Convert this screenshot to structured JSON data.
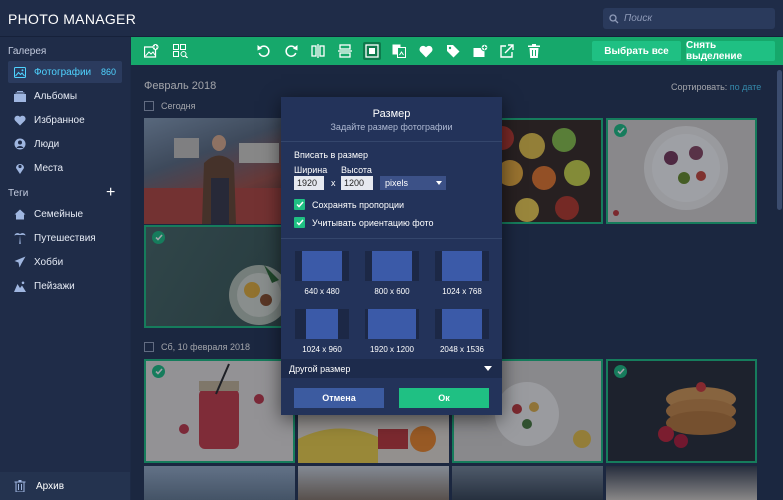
{
  "app": {
    "title": "PHOTO MANAGER"
  },
  "search": {
    "placeholder": "Поиск"
  },
  "sidebar": {
    "gallery_title": "Галерея",
    "gallery_items": [
      {
        "label": "Фотографии",
        "count": "860",
        "icon": "photos-icon"
      },
      {
        "label": "Альбомы",
        "icon": "albums-icon"
      },
      {
        "label": "Избранное",
        "icon": "heart-icon"
      },
      {
        "label": "Люди",
        "icon": "person-icon"
      },
      {
        "label": "Места",
        "icon": "pin-icon"
      }
    ],
    "tags_title": "Теги",
    "tag_items": [
      {
        "label": "Семейные",
        "icon": "house-icon"
      },
      {
        "label": "Путешествия",
        "icon": "palm-icon"
      },
      {
        "label": "Хобби",
        "icon": "plane-icon"
      },
      {
        "label": "Пейзажи",
        "icon": "landscape-icon"
      }
    ],
    "archive_label": "Архив"
  },
  "toolbar": {
    "icons": [
      "add-photo-icon",
      "scan-icon",
      "rotate-left-icon",
      "rotate-right-icon",
      "flip-horizontal-icon",
      "flip-vertical-icon",
      "resize-icon",
      "convert-icon",
      "heart-icon",
      "tag-icon",
      "add-to-album-icon",
      "share-icon",
      "trash-icon"
    ],
    "select_all": "Выбрать все",
    "deselect": "Снять выделение"
  },
  "content": {
    "group1_date": "Февраль 2018",
    "group1_check": "Сегодня",
    "group2_check": "Сб, 10 февраля 2018",
    "sort_label": "Сортировать:",
    "sort_value": "по дате"
  },
  "dialog": {
    "title": "Размер",
    "subtitle": "Задайте размер фотографии",
    "fit_label": "Вписать в размер",
    "width_label": "Ширина",
    "height_label": "Высота",
    "width_value": "1920",
    "height_value": "1200",
    "times": "x",
    "unit": "pixels",
    "keep_ratio": "Сохранять пропорции",
    "use_orientation": "Учитывать ориентацию фото",
    "presets": [
      "640 x 480",
      "800 x 600",
      "1024 x 768",
      "1024 x 960",
      "1920 x 1200",
      "2048 x 1536"
    ],
    "other_size": "Другой размер",
    "cancel": "Отмена",
    "ok": "Ок"
  },
  "colors": {
    "accent_green": "#1fc083",
    "toolbar_green": "#16a86b",
    "link_blue": "#4fd3ff",
    "sidebar_bg": "#1f2c48",
    "content_bg": "#273756"
  }
}
